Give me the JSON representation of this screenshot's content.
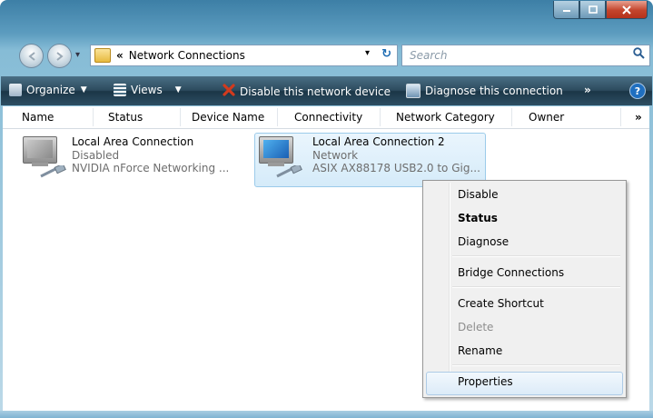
{
  "window": {
    "caption_buttons": [
      "minimize-icon",
      "maximize-icon",
      "close-icon"
    ]
  },
  "address": {
    "chevron": "«",
    "path": "Network Connections",
    "dropdown": "▾",
    "refresh": "↻"
  },
  "search": {
    "placeholder": "Search"
  },
  "toolbar": {
    "organize": "Organize",
    "views": "Views",
    "disable_device": "Disable this network device",
    "diagnose": "Diagnose this connection",
    "more": "»",
    "help": "?"
  },
  "columns": [
    "Name",
    "Status",
    "Device Name",
    "Connectivity",
    "Network Category",
    "Owner",
    "»"
  ],
  "connections": [
    {
      "name": "Local Area Connection",
      "status": "Disabled",
      "device": "NVIDIA nForce Networking ..."
    },
    {
      "name": "Local Area Connection 2",
      "status": "Network",
      "device": "ASIX AX88178 USB2.0 to Gig..."
    }
  ],
  "context_menu": {
    "items": [
      "Disable",
      "Status",
      "Diagnose",
      "Bridge Connections",
      "Create Shortcut",
      "Delete",
      "Rename",
      "Properties"
    ],
    "default_item": "Status",
    "disabled_item": "Delete",
    "highlighted_item": "Properties"
  },
  "colors": {
    "toolbar_bg": "#2c4b5e",
    "selection_border": "#9ccbea",
    "close_button": "#c3442c",
    "disable_icon": "#d23a1e"
  }
}
